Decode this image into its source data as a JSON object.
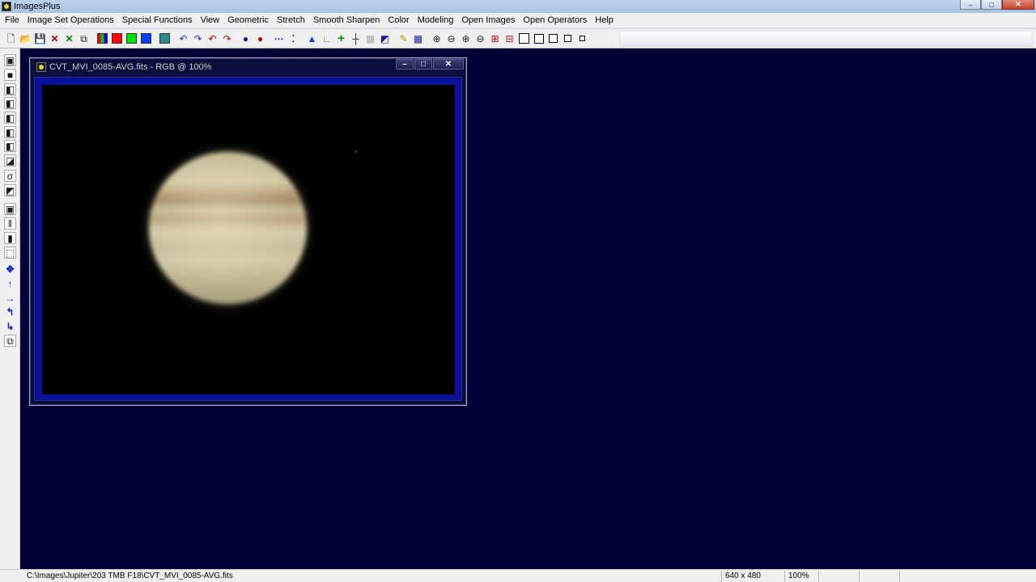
{
  "app": {
    "title": "ImagesPlus",
    "window_buttons": [
      "–",
      "□",
      "✕"
    ]
  },
  "menu": [
    "File",
    "Image Set Operations",
    "Special Functions",
    "View",
    "Geometric",
    "Stretch",
    "Smooth Sharpen",
    "Color",
    "Modeling",
    "Open Images",
    "Open Operators",
    "Help"
  ],
  "toolbar": {
    "glyphs": {
      "new": "🗋",
      "open": "📂",
      "save": "💾",
      "close": "✕",
      "check": "✕",
      "copy": "⧉",
      "undo": "↶",
      "redo": "↷",
      "undo2": "↶",
      "redo2": "↷",
      "circle1": "●",
      "circle2": "●",
      "dots": "⋯",
      "points": "⁚",
      "mountain": "▲",
      "axis": "∟",
      "plus": "+",
      "crosshair": "┼",
      "grid": "▦",
      "stamp": "◩",
      "pencil": "✎",
      "table": "▦",
      "zoom_in": "⊕",
      "zoom_out": "⊖",
      "zoom_fit": "⊕",
      "zoom_small": "⊖",
      "expand": "⊞",
      "shrink": "⊟"
    },
    "colors": {
      "rgb_multi": "#4a66c0",
      "red": "#ff0000",
      "green": "#00e000",
      "blue": "#0040ff",
      "teal": "#2a8a88"
    }
  },
  "left_toolbar": [
    {
      "name": "save-icon",
      "glyph": "▣"
    },
    {
      "name": "black-square-icon",
      "glyph": "■"
    },
    {
      "name": "red-channel-icon",
      "glyph": "◧"
    },
    {
      "name": "green-channel-icon",
      "glyph": "◧"
    },
    {
      "name": "blue-channel-icon",
      "glyph": "◧"
    },
    {
      "name": "blue-channel-icon-2",
      "glyph": "◧"
    },
    {
      "name": "cyan-channel-icon",
      "glyph": "◧"
    },
    {
      "name": "white-square-icon",
      "glyph": "◪"
    },
    {
      "name": "function-icon",
      "glyph": "σ"
    },
    {
      "name": "diagonal-icon",
      "glyph": "◩"
    },
    {
      "name": "target-icon",
      "glyph": "▣"
    },
    {
      "name": "bars-icon",
      "glyph": "⦀"
    },
    {
      "name": "black-bar-icon",
      "glyph": "▮"
    },
    {
      "name": "select-icon",
      "glyph": "⬚"
    },
    {
      "name": "move-icon",
      "glyph": "✥"
    },
    {
      "name": "arrow-up-icon",
      "glyph": "↑"
    },
    {
      "name": "arrow-right-icon",
      "glyph": "→"
    },
    {
      "name": "rotate-left-icon",
      "glyph": "↰"
    },
    {
      "name": "rotate-down-icon",
      "glyph": "↳"
    },
    {
      "name": "page-icon",
      "glyph": "⧉"
    }
  ],
  "image_window": {
    "title": "CVT_MVI_0085-AVG.fits - RGB @ 100%",
    "buttons": [
      "–",
      "□",
      "✕"
    ]
  },
  "status": {
    "path": "C:\\Images\\Jupiter\\203 TMB F18\\CVT_MVI_0085-AVG.fits",
    "dimensions": "640 x 480",
    "zoom": "100%"
  }
}
